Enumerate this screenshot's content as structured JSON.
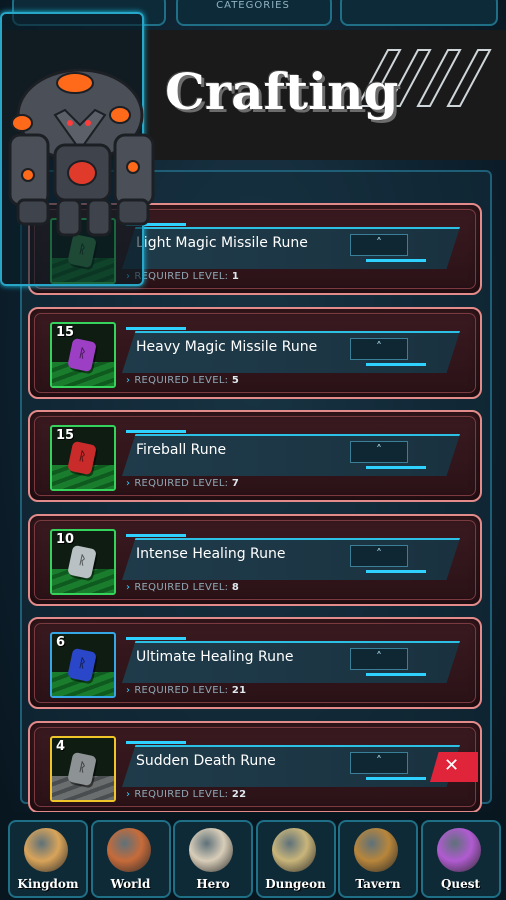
{
  "header": {
    "categories_label": "CATEGORIES",
    "title": "Crafting"
  },
  "recipes": [
    {
      "name": "Light Magic Missile Rune",
      "quantity": "",
      "required_label": "REQUIRED LEVEL:",
      "required_level": "1",
      "rune_color": "#3a8a4a"
    },
    {
      "name": "Heavy Magic Missile Rune",
      "quantity": "15",
      "required_label": "REQUIRED LEVEL:",
      "required_level": "5",
      "rune_color": "#9c3fc4"
    },
    {
      "name": "Fireball Rune",
      "quantity": "15",
      "required_label": "REQUIRED LEVEL:",
      "required_level": "7",
      "rune_color": "#c92b2b"
    },
    {
      "name": "Intense Healing Rune",
      "quantity": "10",
      "required_label": "REQUIRED LEVEL:",
      "required_level": "8",
      "rune_color": "#b9c1c4"
    },
    {
      "name": "Ultimate Healing Rune",
      "quantity": "6",
      "required_label": "REQUIRED LEVEL:",
      "required_level": "21",
      "rune_color": "#2a47c9"
    },
    {
      "name": "Sudden Death Rune",
      "quantity": "4",
      "required_label": "REQUIRED LEVEL:",
      "required_level": "22",
      "rune_color": "#8d9294"
    }
  ],
  "expand_icon": "chevron-up-icon",
  "close_glyph": "✕",
  "nav": [
    {
      "label": "Kingdom",
      "color": "#d9a45a"
    },
    {
      "label": "World",
      "color": "#c76b3a"
    },
    {
      "label": "Hero",
      "color": "#d8cdb8"
    },
    {
      "label": "Dungeon",
      "color": "#c9b57a"
    },
    {
      "label": "Tavern",
      "color": "#b8863b"
    },
    {
      "label": "Quest",
      "color": "#b15bd1"
    }
  ]
}
